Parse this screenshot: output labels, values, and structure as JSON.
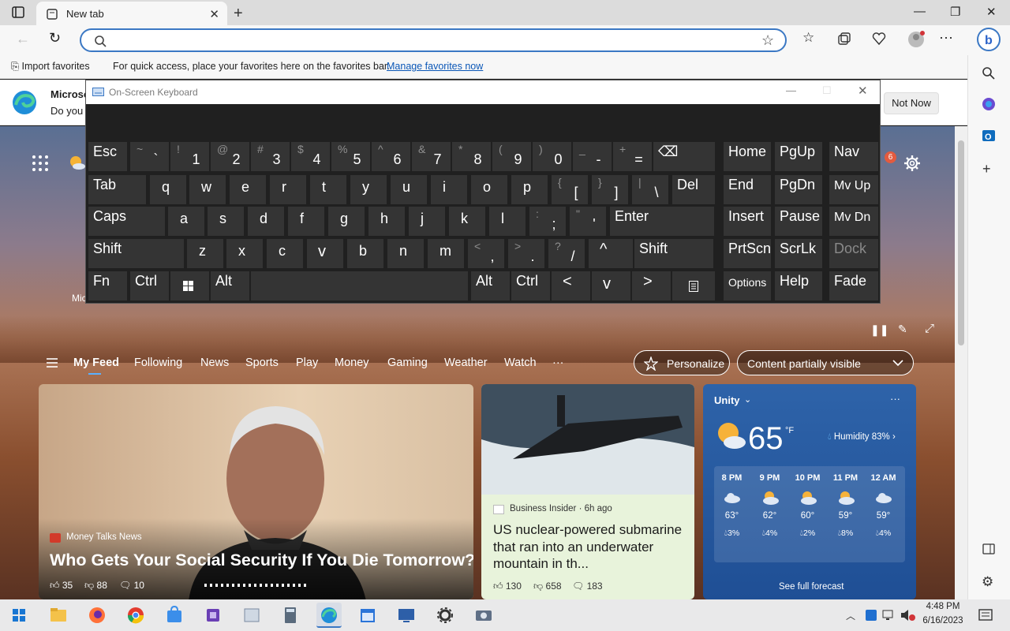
{
  "browser": {
    "tab_title": "New tab",
    "address_value": "",
    "fav_import": "Import favorites",
    "fav_text": "For quick access, place your favorites here on the favorites bar.",
    "fav_link": "Manage favorites now"
  },
  "notification": {
    "title_fragment": "Microso",
    "body_fragment": "Do you",
    "not_now": "Not Now"
  },
  "osk": {
    "title": "On-Screen Keyboard",
    "rows": [
      [
        {
          "lo": "Esc"
        },
        {
          "up": "~",
          "lo": "`"
        },
        {
          "up": "!",
          "lo": "1"
        },
        {
          "up": "@",
          "lo": "2"
        },
        {
          "up": "#",
          "lo": "3"
        },
        {
          "up": "$",
          "lo": "4"
        },
        {
          "up": "%",
          "lo": "5"
        },
        {
          "up": "^",
          "lo": "6"
        },
        {
          "up": "&",
          "lo": "7"
        },
        {
          "up": "*",
          "lo": "8"
        },
        {
          "up": "(",
          "lo": "9"
        },
        {
          "up": ")",
          "lo": "0"
        },
        {
          "up": "_",
          "lo": "-"
        },
        {
          "up": "+",
          "lo": "="
        },
        {
          "lo": "⌫"
        },
        {
          "lo": "Home"
        },
        {
          "lo": "PgUp"
        },
        {
          "lo": "Nav"
        }
      ],
      [
        {
          "lo": "Tab"
        },
        {
          "lo": "q"
        },
        {
          "lo": "w"
        },
        {
          "lo": "e"
        },
        {
          "lo": "r"
        },
        {
          "lo": "t"
        },
        {
          "lo": "y"
        },
        {
          "lo": "u"
        },
        {
          "lo": "i"
        },
        {
          "lo": "o"
        },
        {
          "lo": "p"
        },
        {
          "up": "{",
          "lo": "["
        },
        {
          "up": "}",
          "lo": "]"
        },
        {
          "up": "|",
          "lo": "\\"
        },
        {
          "lo": "Del"
        },
        {
          "lo": "End"
        },
        {
          "lo": "PgDn"
        },
        {
          "lo": "Mv Up"
        }
      ],
      [
        {
          "lo": "Caps"
        },
        {
          "lo": "a"
        },
        {
          "lo": "s"
        },
        {
          "lo": "d"
        },
        {
          "lo": "f"
        },
        {
          "lo": "g"
        },
        {
          "lo": "h"
        },
        {
          "lo": "j"
        },
        {
          "lo": "k"
        },
        {
          "lo": "l"
        },
        {
          "up": ":",
          "lo": ";"
        },
        {
          "up": "\"",
          "lo": "'"
        },
        {
          "lo": "Enter"
        },
        {
          "lo": "Insert"
        },
        {
          "lo": "Pause"
        },
        {
          "lo": "Mv Dn"
        }
      ],
      [
        {
          "lo": "Shift"
        },
        {
          "lo": "z"
        },
        {
          "lo": "x"
        },
        {
          "lo": "c"
        },
        {
          "lo": "v"
        },
        {
          "lo": "b"
        },
        {
          "lo": "n"
        },
        {
          "lo": "m"
        },
        {
          "up": "<",
          "lo": ","
        },
        {
          "up": ">",
          "lo": "."
        },
        {
          "up": "?",
          "lo": "/"
        },
        {
          "lo": "^"
        },
        {
          "lo": "Shift"
        },
        {
          "lo": "PrtScn"
        },
        {
          "lo": "ScrLk"
        },
        {
          "lo": "Dock"
        }
      ],
      [
        {
          "lo": "Fn"
        },
        {
          "lo": "Ctrl"
        },
        {
          "lo": "win"
        },
        {
          "lo": "Alt"
        },
        {
          "lo": ""
        },
        {
          "lo": "Alt"
        },
        {
          "lo": "Ctrl"
        },
        {
          "lo": "<"
        },
        {
          "lo": "v"
        },
        {
          "lo": ">"
        },
        {
          "lo": "menu"
        },
        {
          "lo": "Options"
        },
        {
          "lo": "Help"
        },
        {
          "lo": "Fade"
        }
      ]
    ]
  },
  "msn": {
    "notif_count": "6",
    "partial_label": "Mic",
    "feed_tabs": [
      "My Feed",
      "Following",
      "News",
      "Sports",
      "Play",
      "Money",
      "Gaming",
      "Weather",
      "Watch",
      "···"
    ],
    "personalize": "Personalize",
    "content_visible": "Content partially visible"
  },
  "cards": {
    "main": {
      "source": "Money Talks News",
      "title": "Who Gets Your Social Security If You Die Tomorrow?",
      "likes": "35",
      "dislikes": "88",
      "comments": "10"
    },
    "second": {
      "source": "Business Insider · 6h ago",
      "title": "US nuclear-powered submarine that ran into an underwater mountain in th...",
      "likes": "130",
      "dislikes": "658",
      "comments": "183"
    },
    "weather": {
      "location": "Unity",
      "temp": "65",
      "unit": "°F",
      "humidity": "Humidity 83%",
      "hours": [
        {
          "time": "8 PM",
          "temp": "63°",
          "precip": "3%"
        },
        {
          "time": "9 PM",
          "temp": "62°",
          "precip": "4%"
        },
        {
          "time": "10 PM",
          "temp": "60°",
          "precip": "2%"
        },
        {
          "time": "11 PM",
          "temp": "59°",
          "precip": "8%"
        },
        {
          "time": "12 AM",
          "temp": "59°",
          "precip": "4%"
        }
      ],
      "forecast_link": "See full forecast"
    }
  },
  "taskbar": {
    "time": "4:48 PM",
    "date": "6/16/2023"
  }
}
